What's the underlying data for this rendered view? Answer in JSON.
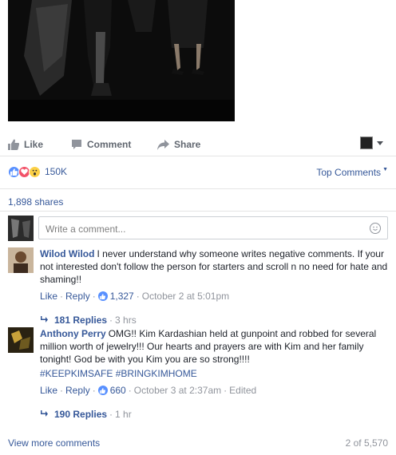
{
  "post_actions": {
    "like": "Like",
    "comment": "Comment",
    "share": "Share"
  },
  "reactions": {
    "count": "150K",
    "sort_label": "Top Comments"
  },
  "shares_text": "1,898 shares",
  "composer": {
    "placeholder": "Write a comment..."
  },
  "comments": [
    {
      "author": "Wilod Wilod",
      "text": "I never understand why someone writes negative comments. If your not interested don't follow the person for starters and scroll n no need for hate and shaming!!",
      "like": "Like",
      "reply": "Reply",
      "like_count": "1,327",
      "timestamp": "October 2 at 5:01pm",
      "replies_label": "181 Replies",
      "replies_age": "3 hrs"
    },
    {
      "author": "Anthony Perry",
      "text": "OMG!! Kim Kardashian held at gunpoint and robbed for several million worth of jewelry!!! Our hearts and prayers are with Kim and her family tonight! God be with you Kim you are so strong!!!!",
      "hashtags": "#KEEPKIMSAFE #BRINGKIMHOME",
      "like": "Like",
      "reply": "Reply",
      "like_count": "660",
      "timestamp": "October 3 at 2:37am",
      "edited": "Edited",
      "replies_label": "190 Replies",
      "replies_age": "1 hr"
    }
  ],
  "footer": {
    "view_more": "View more comments",
    "count": "2 of 5,570"
  },
  "colors": {
    "link": "#365899",
    "muted": "#90949c",
    "like_blue": "#5890ff",
    "love_red": "#f25268",
    "wow_yellow": "#fcd046"
  }
}
